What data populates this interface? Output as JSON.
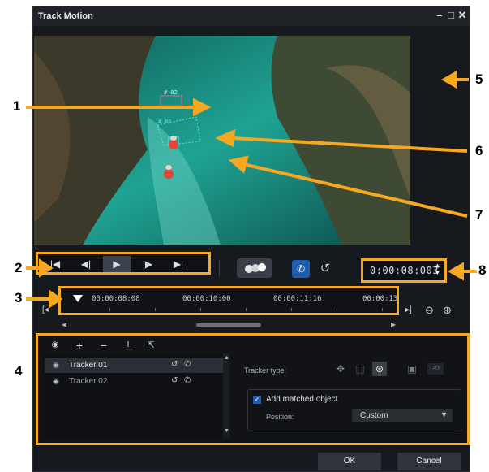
{
  "window": {
    "title": "Track Motion",
    "minimize_glyph": "–",
    "maximize_glyph": "□",
    "close_glyph": "✕"
  },
  "preview": {
    "tracker_labels": [
      "# 02",
      "# 01"
    ]
  },
  "transport": {
    "buttons": [
      {
        "name": "go-to-start",
        "glyph": "|◀"
      },
      {
        "name": "previous-frame",
        "glyph": "◀|"
      },
      {
        "name": "play",
        "glyph": "▶"
      },
      {
        "name": "next-frame",
        "glyph": "|▶"
      },
      {
        "name": "go-to-end",
        "glyph": "▶|"
      }
    ],
    "timecode": "0:00:08:003",
    "spin_up": "▲",
    "spin_down": "▼"
  },
  "timeline": {
    "ticks": [
      "00:00:08:08",
      "00:00:10:00",
      "00:00:11:16",
      "00:00:13"
    ]
  },
  "panel": {
    "trackers": [
      {
        "label": "Tracker 01",
        "selected": true
      },
      {
        "label": "Tracker 02",
        "selected": false
      }
    ],
    "tracker_type_label": "Tracker type:",
    "tracker_size": "20",
    "add_matched_object_label": "Add matched object",
    "add_matched_object_checked": true,
    "position_label": "Position:",
    "position_value": "Custom"
  },
  "footer": {
    "ok_label": "OK",
    "cancel_label": "Cancel"
  },
  "callouts": [
    "1",
    "2",
    "3",
    "4",
    "5",
    "6",
    "7",
    "8"
  ],
  "colors": {
    "callout_orange": "#f7a823",
    "window_bg": "#16191d",
    "accent_blue": "#1e5eb0",
    "tracker_magenta": "#e0609a",
    "tracker_cyan": "#56e3e8"
  }
}
